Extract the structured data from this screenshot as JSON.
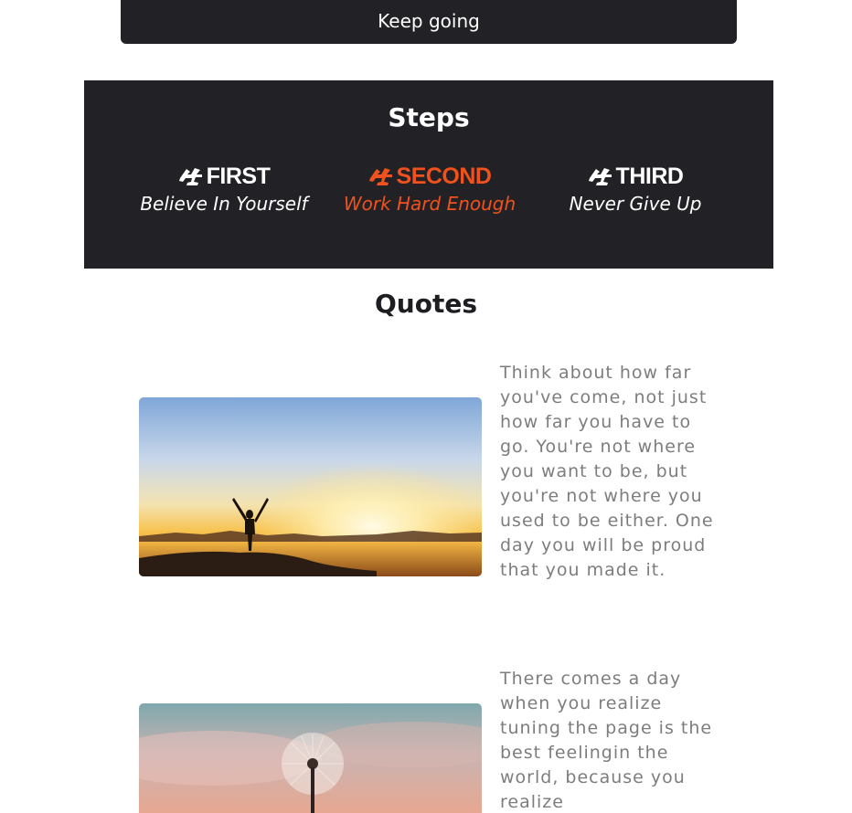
{
  "header": {
    "cta_label": "Keep going"
  },
  "steps": {
    "title": "Steps",
    "items": [
      {
        "label": "FIRST",
        "subtitle": "Believe In Yourself",
        "icon": "runner-icon"
      },
      {
        "label": "SECOND",
        "subtitle": "Work Hard Enough",
        "icon": "runner-icon"
      },
      {
        "label": "THIRD",
        "subtitle": "Never Give Up",
        "icon": "runner-icon"
      }
    ],
    "active_index": 1
  },
  "quotes": {
    "title": "Quotes",
    "items": [
      {
        "text": "Think about how far you've come, not just how far you have to go. You're not where you want to be, but you're not where you used to be either. One day you will be proud that you made it.",
        "image": "sunset-person-image"
      },
      {
        "text": "There comes a day when you realize tuning the page is the best feelingin the world, because you realize",
        "image": "dandelion-image"
      }
    ]
  },
  "colors": {
    "dark_bg": "#222226",
    "accent": "#f0511d",
    "quote_text": "#7d7d7d"
  }
}
